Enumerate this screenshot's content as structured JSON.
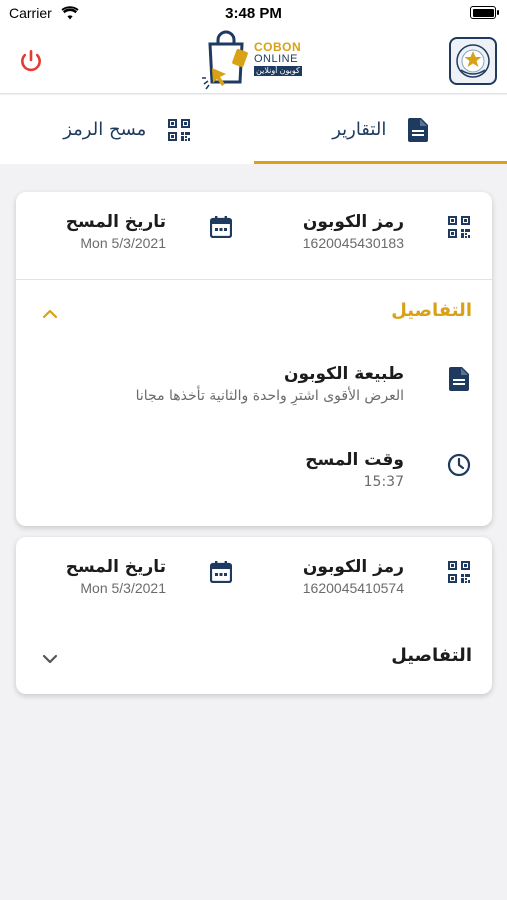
{
  "status_bar": {
    "carrier": "Carrier",
    "time": "3:48 PM"
  },
  "header": {
    "logo": {
      "line1": "COBON",
      "line2": "ONLINE",
      "line3": "كوبون أونلاين"
    },
    "accent_color": "#d9a116",
    "primary_color": "#1e3a5f",
    "power_color": "#e53935"
  },
  "tabs": [
    {
      "label": "التقارير",
      "icon": "document-icon",
      "active": true
    },
    {
      "label": "مسح الرمز",
      "icon": "qr-code-icon",
      "active": false
    }
  ],
  "scans": [
    {
      "coupon_label": "رمز الكوبون",
      "coupon_value": "1620045430183",
      "date_label": "تاريخ المسح",
      "date_value": "Mon 5/3/2021",
      "details_label": "التفاصيل",
      "expanded": true,
      "details": [
        {
          "icon": "document-icon",
          "label": "طبيعة الكوبون",
          "value": "العرض الأقوى اشترِ واحدة والثانية تأخذها مجانا"
        },
        {
          "icon": "clock-icon",
          "label": "وقت المسح",
          "value": "15:37"
        }
      ]
    },
    {
      "coupon_label": "رمز الكوبون",
      "coupon_value": "1620045410574",
      "date_label": "تاريخ المسح",
      "date_value": "Mon 5/3/2021",
      "details_label": "التفاصيل",
      "expanded": false
    }
  ]
}
